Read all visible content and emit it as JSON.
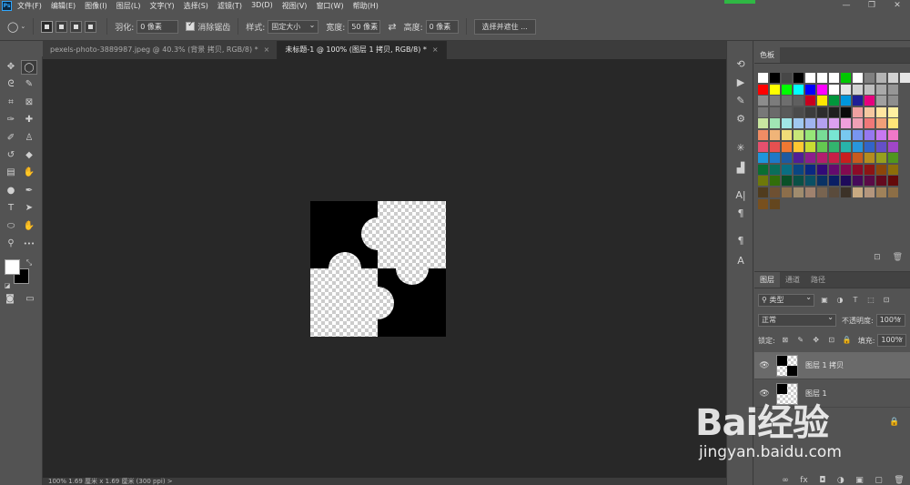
{
  "app": {
    "logo": "Ps"
  },
  "menu": [
    "文件(F)",
    "编辑(E)",
    "图像(I)",
    "图层(L)",
    "文字(Y)",
    "选择(S)",
    "滤镜(T)",
    "3D(D)",
    "视图(V)",
    "窗口(W)",
    "帮助(H)"
  ],
  "window_controls": {
    "minimize": "—",
    "restore": "❐",
    "close": "✕"
  },
  "options": {
    "feather_label": "羽化:",
    "feather_value": "0 像素",
    "antialias_label": "消除锯齿",
    "style_label": "样式:",
    "style_value": "固定大小",
    "width_label": "宽度:",
    "width_value": "50 像素",
    "swap_icon": "⇄",
    "height_label": "高度:",
    "height_value": "0 像素",
    "select_mask_button": "选择并遮住 ..."
  },
  "tabs": [
    {
      "label": "pexels-photo-3889987.jpeg @ 40.3% (背景 拷贝, RGB/8) *",
      "active": false
    },
    {
      "label": "未标题-1 @ 100% (图层 1 拷贝, RGB/8) *",
      "active": true
    }
  ],
  "tab_close": "×",
  "tools": [
    {
      "name": "move-tool-icon",
      "glyph": "✥"
    },
    {
      "name": "elliptical-marquee-tool-icon",
      "glyph": "◯"
    },
    {
      "name": "lasso-tool-icon",
      "glyph": "ᘓ"
    },
    {
      "name": "quick-selection-tool-icon",
      "glyph": "✎"
    },
    {
      "name": "crop-tool-icon",
      "glyph": "⌗"
    },
    {
      "name": "frame-tool-icon",
      "glyph": "⊠"
    },
    {
      "name": "eyedropper-tool-icon",
      "glyph": "✑"
    },
    {
      "name": "healing-brush-tool-icon",
      "glyph": "✚"
    },
    {
      "name": "brush-tool-icon",
      "glyph": "✐"
    },
    {
      "name": "clone-stamp-tool-icon",
      "glyph": "♙"
    },
    {
      "name": "history-brush-tool-icon",
      "glyph": "↺"
    },
    {
      "name": "eraser-tool-icon",
      "glyph": "◆"
    },
    {
      "name": "gradient-tool-icon",
      "glyph": "▤"
    },
    {
      "name": "blur-tool-icon",
      "glyph": "✋"
    },
    {
      "name": "dodge-tool-icon",
      "glyph": "●"
    },
    {
      "name": "pen-tool-icon",
      "glyph": "✒"
    },
    {
      "name": "type-tool-icon",
      "glyph": "T"
    },
    {
      "name": "path-selection-tool-icon",
      "glyph": "➤"
    },
    {
      "name": "ellipse-tool-icon",
      "glyph": "⬭"
    },
    {
      "name": "hand-tool-icon",
      "glyph": "✋"
    },
    {
      "name": "zoom-tool-icon",
      "glyph": "⚲"
    },
    {
      "name": "more-tools-icon",
      "glyph": "•••"
    }
  ],
  "strip_icons": [
    {
      "name": "history-icon",
      "glyph": "⟲"
    },
    {
      "name": "actions-play-icon",
      "glyph": "▶"
    },
    {
      "name": "brush-settings-icon",
      "glyph": "✎"
    },
    {
      "name": "adjustments-icon",
      "glyph": "⚙"
    },
    {
      "name": "libraries-icon",
      "glyph": "✳"
    },
    {
      "name": "histogram-icon",
      "glyph": "▟"
    },
    {
      "name": "character-icon",
      "glyph": "A|"
    },
    {
      "name": "paragraph-icon",
      "glyph": "¶"
    },
    {
      "name": "paragraph-styles-icon",
      "glyph": "¶"
    },
    {
      "name": "character-styles-icon",
      "glyph": "A"
    }
  ],
  "swatches": {
    "tab": "色板",
    "rows": [
      [
        "#ffffff",
        "#000000",
        "#474747",
        "#000000",
        "#ffffff",
        "#ffffff",
        "#ffffff",
        "#00c800",
        "#ffffff",
        "#808080",
        "#b4b4b4",
        "#d2d2d2",
        "#e6e6e6"
      ],
      [
        "#ff0000",
        "#ffff00",
        "#00ff00",
        "#00ffff",
        "#0000ff",
        "#ff00ff",
        "#ffffff",
        "#e6e6e6",
        "#d2d2d2",
        "#bebebe",
        "#a9a9a9",
        "#969696"
      ],
      [
        "#8c8c8c",
        "#7c7c7c",
        "#6e6e6e",
        "#5f5f5f",
        "#c8001e",
        "#ffe600",
        "#00963c",
        "#0096dc",
        "#1e1e96",
        "#e6007e",
        "#a0a0a0",
        "#8e8e8e"
      ],
      [
        "#787878",
        "#6b6b6b",
        "#5a5a5a",
        "#4b4b4b",
        "#3c3c3c",
        "#2d2d2d",
        "#1e1e1e",
        "#0a0a0a",
        "#f0a0a0",
        "#f5c8a0",
        "#ffe6a0",
        "#fff0a0"
      ],
      [
        "#c8e6a0",
        "#a0e6b4",
        "#a0e6e6",
        "#a0c8f0",
        "#a0b4f0",
        "#b4a0f0",
        "#dca0f0",
        "#f0a0dc",
        "#f0a0b4",
        "#f07878",
        "#f0a078",
        "#ffe678"
      ],
      [
        "#f08c64",
        "#f0b478",
        "#f0dc78",
        "#c8e678",
        "#96e678",
        "#78dc96",
        "#78e6d2",
        "#78c8f0",
        "#7896f0",
        "#9678f0",
        "#c878f0",
        "#f078c8"
      ],
      [
        "#e6506e",
        "#e65050",
        "#f07832",
        "#ffc832",
        "#c8dc32",
        "#64c850",
        "#32b46e",
        "#28b4aa",
        "#2896dc",
        "#3264c8",
        "#6450c8",
        "#a046c8"
      ],
      [
        "#1e96dc",
        "#1e78c8",
        "#1e5aa0",
        "#501e96",
        "#8c1e8c",
        "#b41e6e",
        "#c81e46",
        "#c81e1e",
        "#c85a1e",
        "#b48c1e",
        "#96a01e",
        "#50961e"
      ],
      [
        "#0a6e32",
        "#0a6e5a",
        "#0a6e82",
        "#0a4682",
        "#0a2882",
        "#320a78",
        "#640a6e",
        "#820a50",
        "#8c0a28",
        "#8c1414",
        "#8c460a",
        "#8c6e0a"
      ],
      [
        "#6e780a",
        "#326e0a",
        "#0a5028",
        "#0a5046",
        "#0a5064",
        "#0a3264",
        "#0a1e64",
        "#1e0a5a",
        "#460a5a",
        "#5a0a46",
        "#640a1e",
        "#640a0a"
      ],
      [
        "#503c1e",
        "#6e5032",
        "#8c6e4b",
        "#a08c6e",
        "#a0826e",
        "#786450",
        "#5a4b3c",
        "#3c3228",
        "#c8aa82",
        "#b4967d",
        "#a0825a",
        "#8c6e46"
      ],
      [
        "#78501e",
        "#64461e"
      ]
    ]
  },
  "layers": {
    "tabs": [
      "图层",
      "通道",
      "路径"
    ],
    "filter_label": "类型",
    "blend_mode": "正常",
    "opacity_label": "不透明度:",
    "opacity_value": "100%",
    "lock_label": "锁定:",
    "fill_label": "填充:",
    "fill_value": "100%",
    "items": [
      {
        "name": "图层 1 拷贝",
        "selected": true
      },
      {
        "name": "图层 1",
        "selected": false
      }
    ],
    "bottom_icons": [
      "∞",
      "fx",
      "◘",
      "◑",
      "▣",
      "▢",
      "🗑"
    ]
  },
  "status": {
    "text": "100%    1.69 厘米 x 1.69 厘米 (300 ppi)    >"
  },
  "watermark": {
    "logo": "Bai经验",
    "url": "jingyan.baidu.com"
  }
}
